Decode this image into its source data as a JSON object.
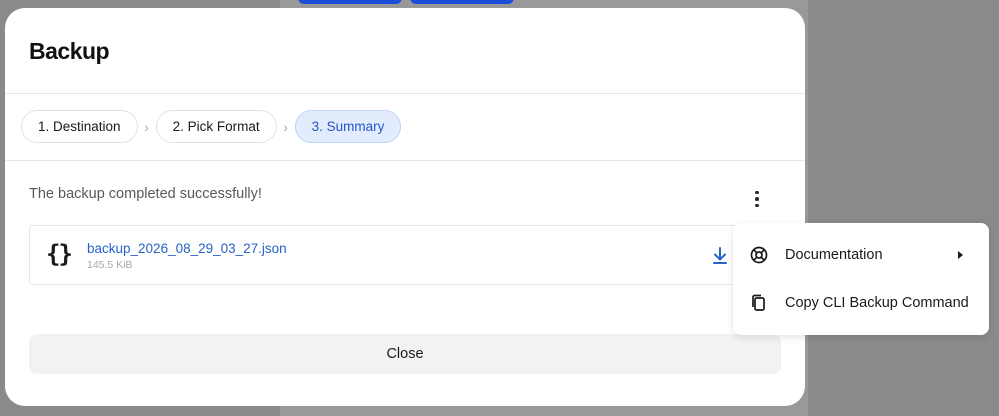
{
  "modal": {
    "title": "Backup",
    "steps": [
      {
        "label": "1. Destination"
      },
      {
        "label": "2. Pick Format"
      },
      {
        "label": "3. Summary"
      }
    ],
    "success_message": "The backup completed successfully!",
    "file": {
      "name": "backup_2026_08_29_03_27.json",
      "size": "145.5 KiB",
      "icon_glyph": "{}"
    },
    "close_label": "Close"
  },
  "menu": {
    "items": [
      {
        "label": "Documentation",
        "icon": "lifebuoy-icon",
        "has_submenu": true
      },
      {
        "label": "Copy CLI Backup Command",
        "icon": "copy-icon",
        "has_submenu": false
      }
    ]
  },
  "colors": {
    "accent": "#2563c9",
    "active_step_bg": "#e2ecfd",
    "backdrop": "#8a8a8a"
  }
}
